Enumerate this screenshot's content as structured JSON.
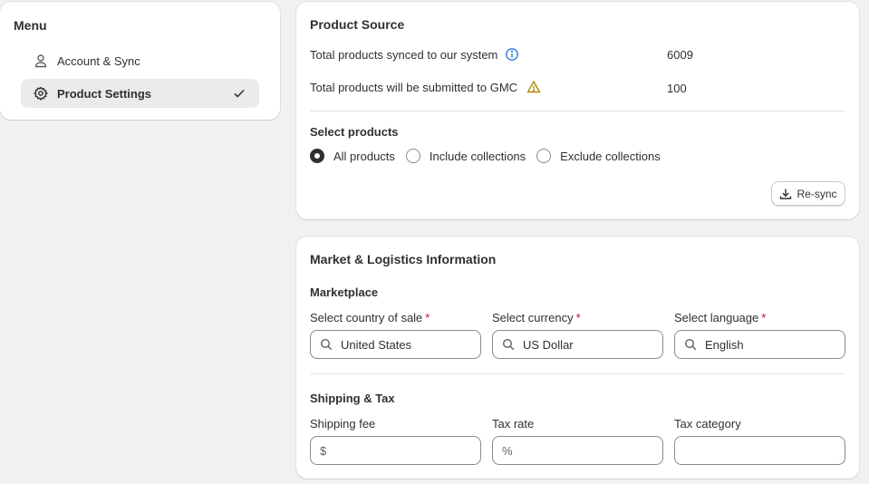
{
  "menu": {
    "title": "Menu",
    "items": [
      {
        "label": "Account & Sync",
        "icon": "user-icon",
        "active": false
      },
      {
        "label": "Product Settings",
        "icon": "gear-icon",
        "active": true
      }
    ]
  },
  "product_source": {
    "title": "Product Source",
    "rows": [
      {
        "label": "Total products synced to our system",
        "value": "6009",
        "icon": "info-icon"
      },
      {
        "label": "Total products will be submitted to GMC",
        "value": "100",
        "icon": "warning-icon"
      }
    ],
    "select_title": "Select products",
    "options": [
      {
        "label": "All products",
        "checked": true
      },
      {
        "label": "Include collections",
        "checked": false
      },
      {
        "label": "Exclude collections",
        "checked": false
      }
    ],
    "resync_label": "Re-sync"
  },
  "market": {
    "title": "Market & Logistics Information",
    "marketplace_title": "Marketplace",
    "country": {
      "label": "Select country of sale",
      "value": "United States",
      "required": "*"
    },
    "currency": {
      "label": "Select currency",
      "value": "US Dollar",
      "required": "*"
    },
    "language": {
      "label": "Select language",
      "value": "English",
      "required": "*"
    },
    "shipping_title": "Shipping & Tax",
    "shipping_fee": {
      "label": "Shipping fee",
      "prefix": "$",
      "value": ""
    },
    "tax_rate": {
      "label": "Tax rate",
      "prefix": "%",
      "value": ""
    },
    "tax_category": {
      "label": "Tax category",
      "value": ""
    }
  },
  "colors": {
    "info": "#2a7ad6",
    "warning": "#b98900",
    "required": "#c70a24"
  }
}
